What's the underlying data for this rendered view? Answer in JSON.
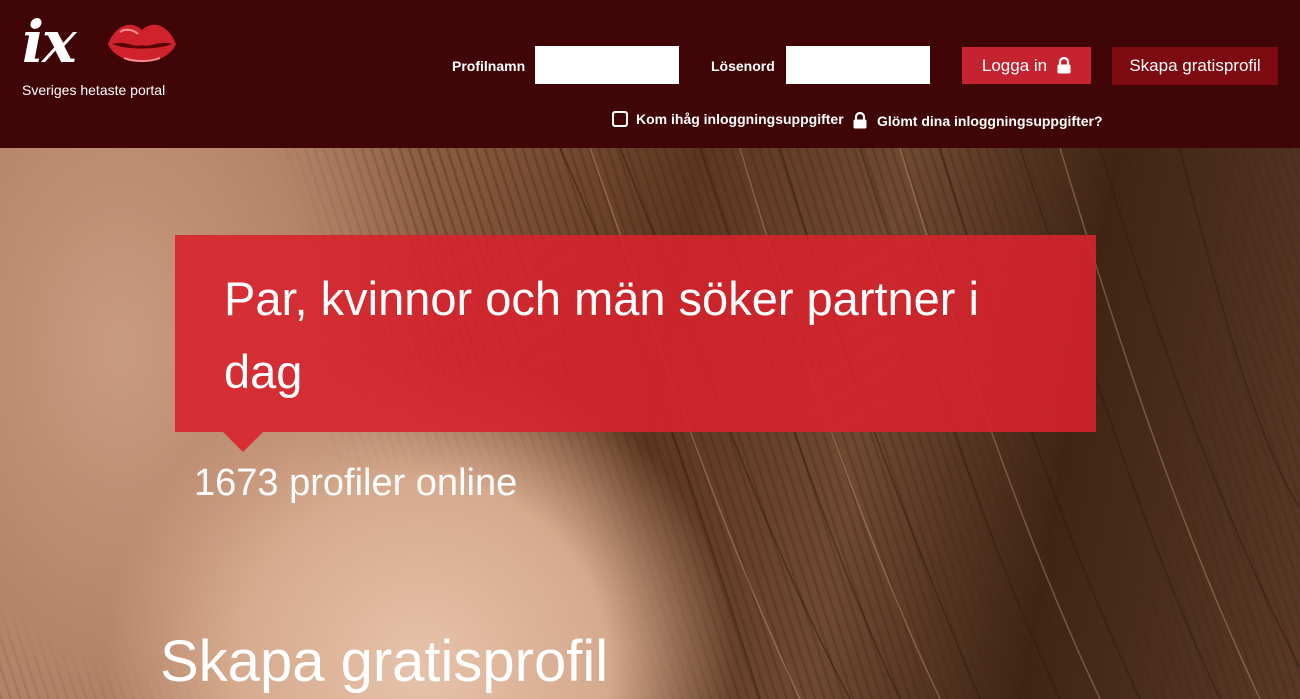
{
  "header": {
    "logo_text": "ix",
    "tagline": "Sveriges hetaste portal",
    "username_label": "Profilnamn",
    "username_value": "",
    "password_label": "Lösenord",
    "password_value": "",
    "login_button": "Logga in",
    "create_profile_button": "Skapa gratisprofil",
    "remember_label": "Kom ihåg inloggningsuppgifter",
    "forgot_label": "Glömt dina inloggningsuppgifter?"
  },
  "hero": {
    "headline": "Par, kvinnor och män söker partner i dag",
    "online_count": "1673 profiler online",
    "create_heading": "Skapa gratisprofil"
  },
  "colors": {
    "header_bg": "#3f0507",
    "accent_red": "#c5232f",
    "dark_red": "#7c0a10"
  },
  "icons": [
    "lips-logo-icon",
    "lock-icon",
    "checkbox-icon"
  ]
}
